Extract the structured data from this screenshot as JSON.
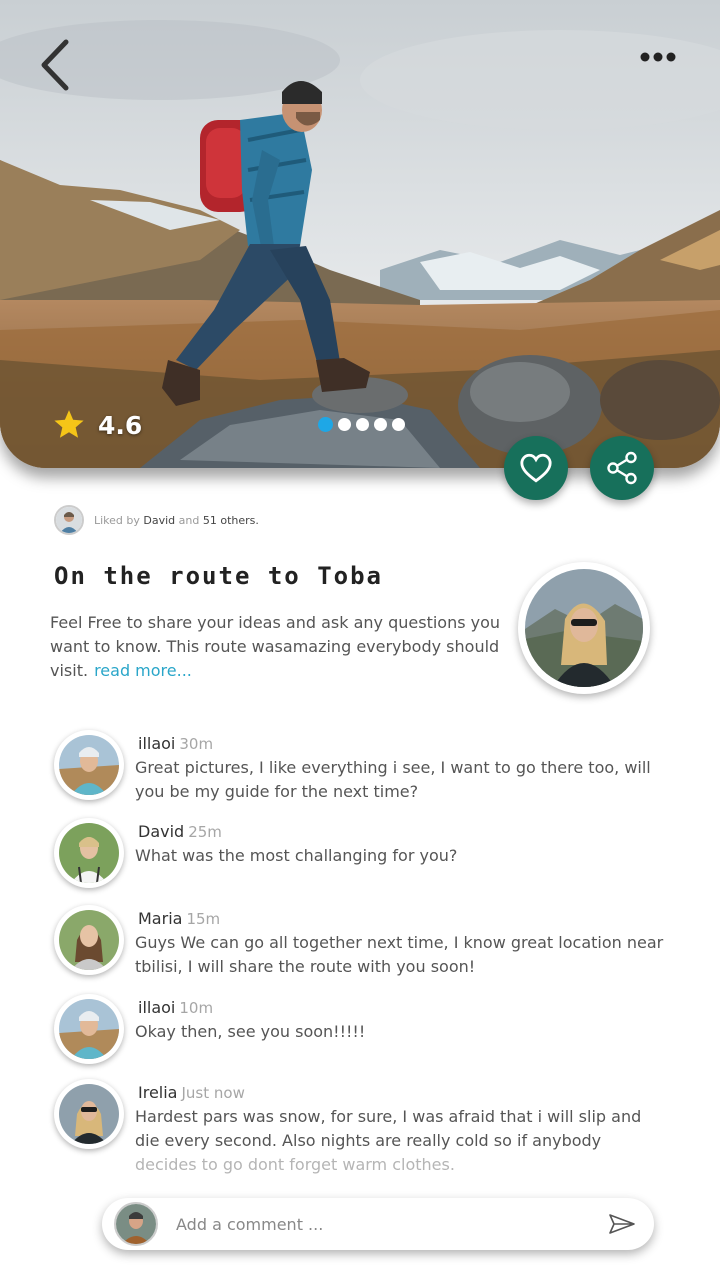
{
  "hero": {
    "rating": "4.6",
    "slides": 5,
    "active_slide": 0
  },
  "likes": {
    "prefix": "Liked by",
    "name": "David",
    "conjunction": "and",
    "others": "51 others."
  },
  "post": {
    "title": "On the route to Toba",
    "description": "Feel Free to share your ideas and ask any questions you want to know. This route wasamazing everybody should visit.",
    "read_more": "read more..."
  },
  "comments": [
    {
      "name": "illaoi",
      "time": "30m",
      "text": "Great pictures, I like everything i see, I want to go there too, will you be my guide for the next time?"
    },
    {
      "name": "David",
      "time": "25m",
      "text": "What was the most challanging for you?"
    },
    {
      "name": "Maria",
      "time": "15m",
      "text": "Guys We can go all together next time, I know great location near tbilisi, I will share the route with you soon!"
    },
    {
      "name": "illaoi",
      "time": "10m",
      "text": "Okay then, see you soon!!!!!"
    },
    {
      "name": "Irelia",
      "time": "Just now",
      "text_main": "Hardest pars was snow, for sure, I was afraid that i will slip and die every second. Also nights are really cold so if anybody",
      "text_faded": "decides to go dont forget warm clothes."
    }
  ],
  "composer": {
    "placeholder": "Add a comment ..."
  },
  "colors": {
    "accent_green": "#17705b",
    "link_blue": "#2aa6c9",
    "active_dot": "#1ea7e6",
    "star": "#f5c518"
  },
  "icons": {
    "back": "chevron-left-icon",
    "more": "more-horizontal-icon",
    "star": "star-icon",
    "like": "heart-icon",
    "share": "share-icon",
    "send": "send-icon"
  }
}
